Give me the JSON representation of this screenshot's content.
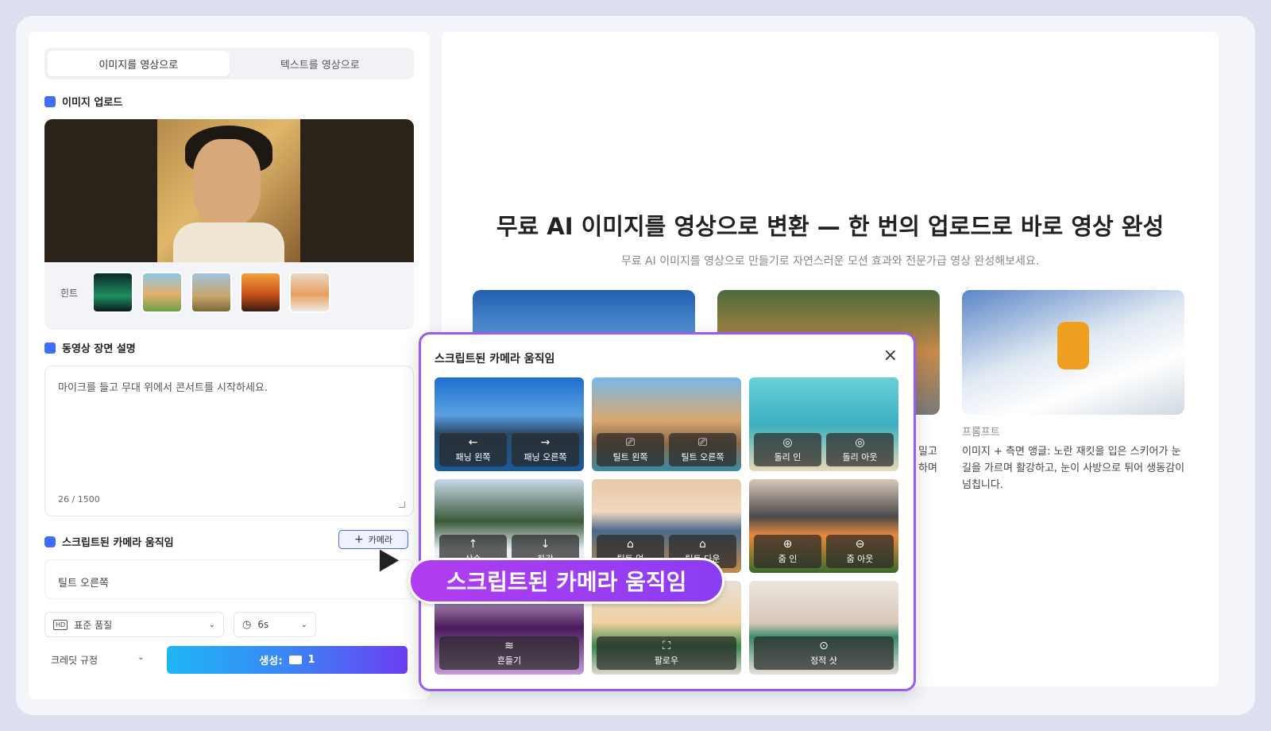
{
  "tabs": {
    "image_to_video": "이미지를 영상으로",
    "text_to_video": "텍스트를 영상으로"
  },
  "upload": {
    "title": "이미지 업로드",
    "hint_label": "힌트"
  },
  "scene": {
    "title": "동영상 장면 설명",
    "text": "마이크를 들고 무대 위에서 콘서트를 시작하세요.",
    "count": "26 / 1500"
  },
  "camera": {
    "title": "스크립트된 카메라 움직임",
    "add_button": "카메라",
    "value": "틸트 오른쪽"
  },
  "controls": {
    "quality": "표준 품질",
    "quality_badge": "HD",
    "duration": "6s",
    "credit_rule": "크레딧 규정",
    "generate": "생성:",
    "generate_count": "1"
  },
  "hero": {
    "title": "무료 AI 이미지를 영상으로 변환 — 한 번의 업로드로 바로 영상 완성",
    "subtitle": "무료 AI 이미지를 영상으로 만들기로 자연스러운 모션 효과와 전문가급 영상 완성해보세요.",
    "prompt_label": "프롬프트",
    "prompt_text": "이미지 + 측면 앵글: 노란 재킷을 입은 스키어가 눈길을 가르며 활강하고, 눈이 사방으로 튀어 생동감이 넘칩니다.",
    "partial_text": "밀고\n하며"
  },
  "popup": {
    "title": "스크립트된 카메라 움직임",
    "close": "×",
    "cells": [
      {
        "buttons": [
          {
            "icon": "←",
            "label": "패닝 왼쪽"
          },
          {
            "icon": "→",
            "label": "패닝 오른쪽"
          }
        ]
      },
      {
        "buttons": [
          {
            "icon": "⎚",
            "label": "틸트 왼쪽"
          },
          {
            "icon": "⎚",
            "label": "틸트 오른쪽"
          }
        ]
      },
      {
        "buttons": [
          {
            "icon": "◎",
            "label": "돌리 인"
          },
          {
            "icon": "◎",
            "label": "돌리 아웃"
          }
        ]
      },
      {
        "buttons": [
          {
            "icon": "↑",
            "label": "상승"
          },
          {
            "icon": "↓",
            "label": "하강"
          }
        ]
      },
      {
        "buttons": [
          {
            "icon": "⌂",
            "label": "틸트 업"
          },
          {
            "icon": "⌂",
            "label": "틸트 다운"
          }
        ]
      },
      {
        "buttons": [
          {
            "icon": "⊕",
            "label": "줌 인"
          },
          {
            "icon": "⊖",
            "label": "줌 아웃"
          }
        ]
      },
      {
        "buttons": [
          {
            "icon": "≋",
            "label": "흔들기"
          }
        ]
      },
      {
        "buttons": [
          {
            "icon": "⛶",
            "label": "팔로우"
          }
        ]
      },
      {
        "buttons": [
          {
            "icon": "⊙",
            "label": "정적 샷"
          }
        ]
      }
    ]
  },
  "banner": "스크립트된 카메라 움직임",
  "colors": {
    "accent": "#3d6ef7",
    "popup_border": "#9b5cf0",
    "banner": "#a23df1"
  }
}
